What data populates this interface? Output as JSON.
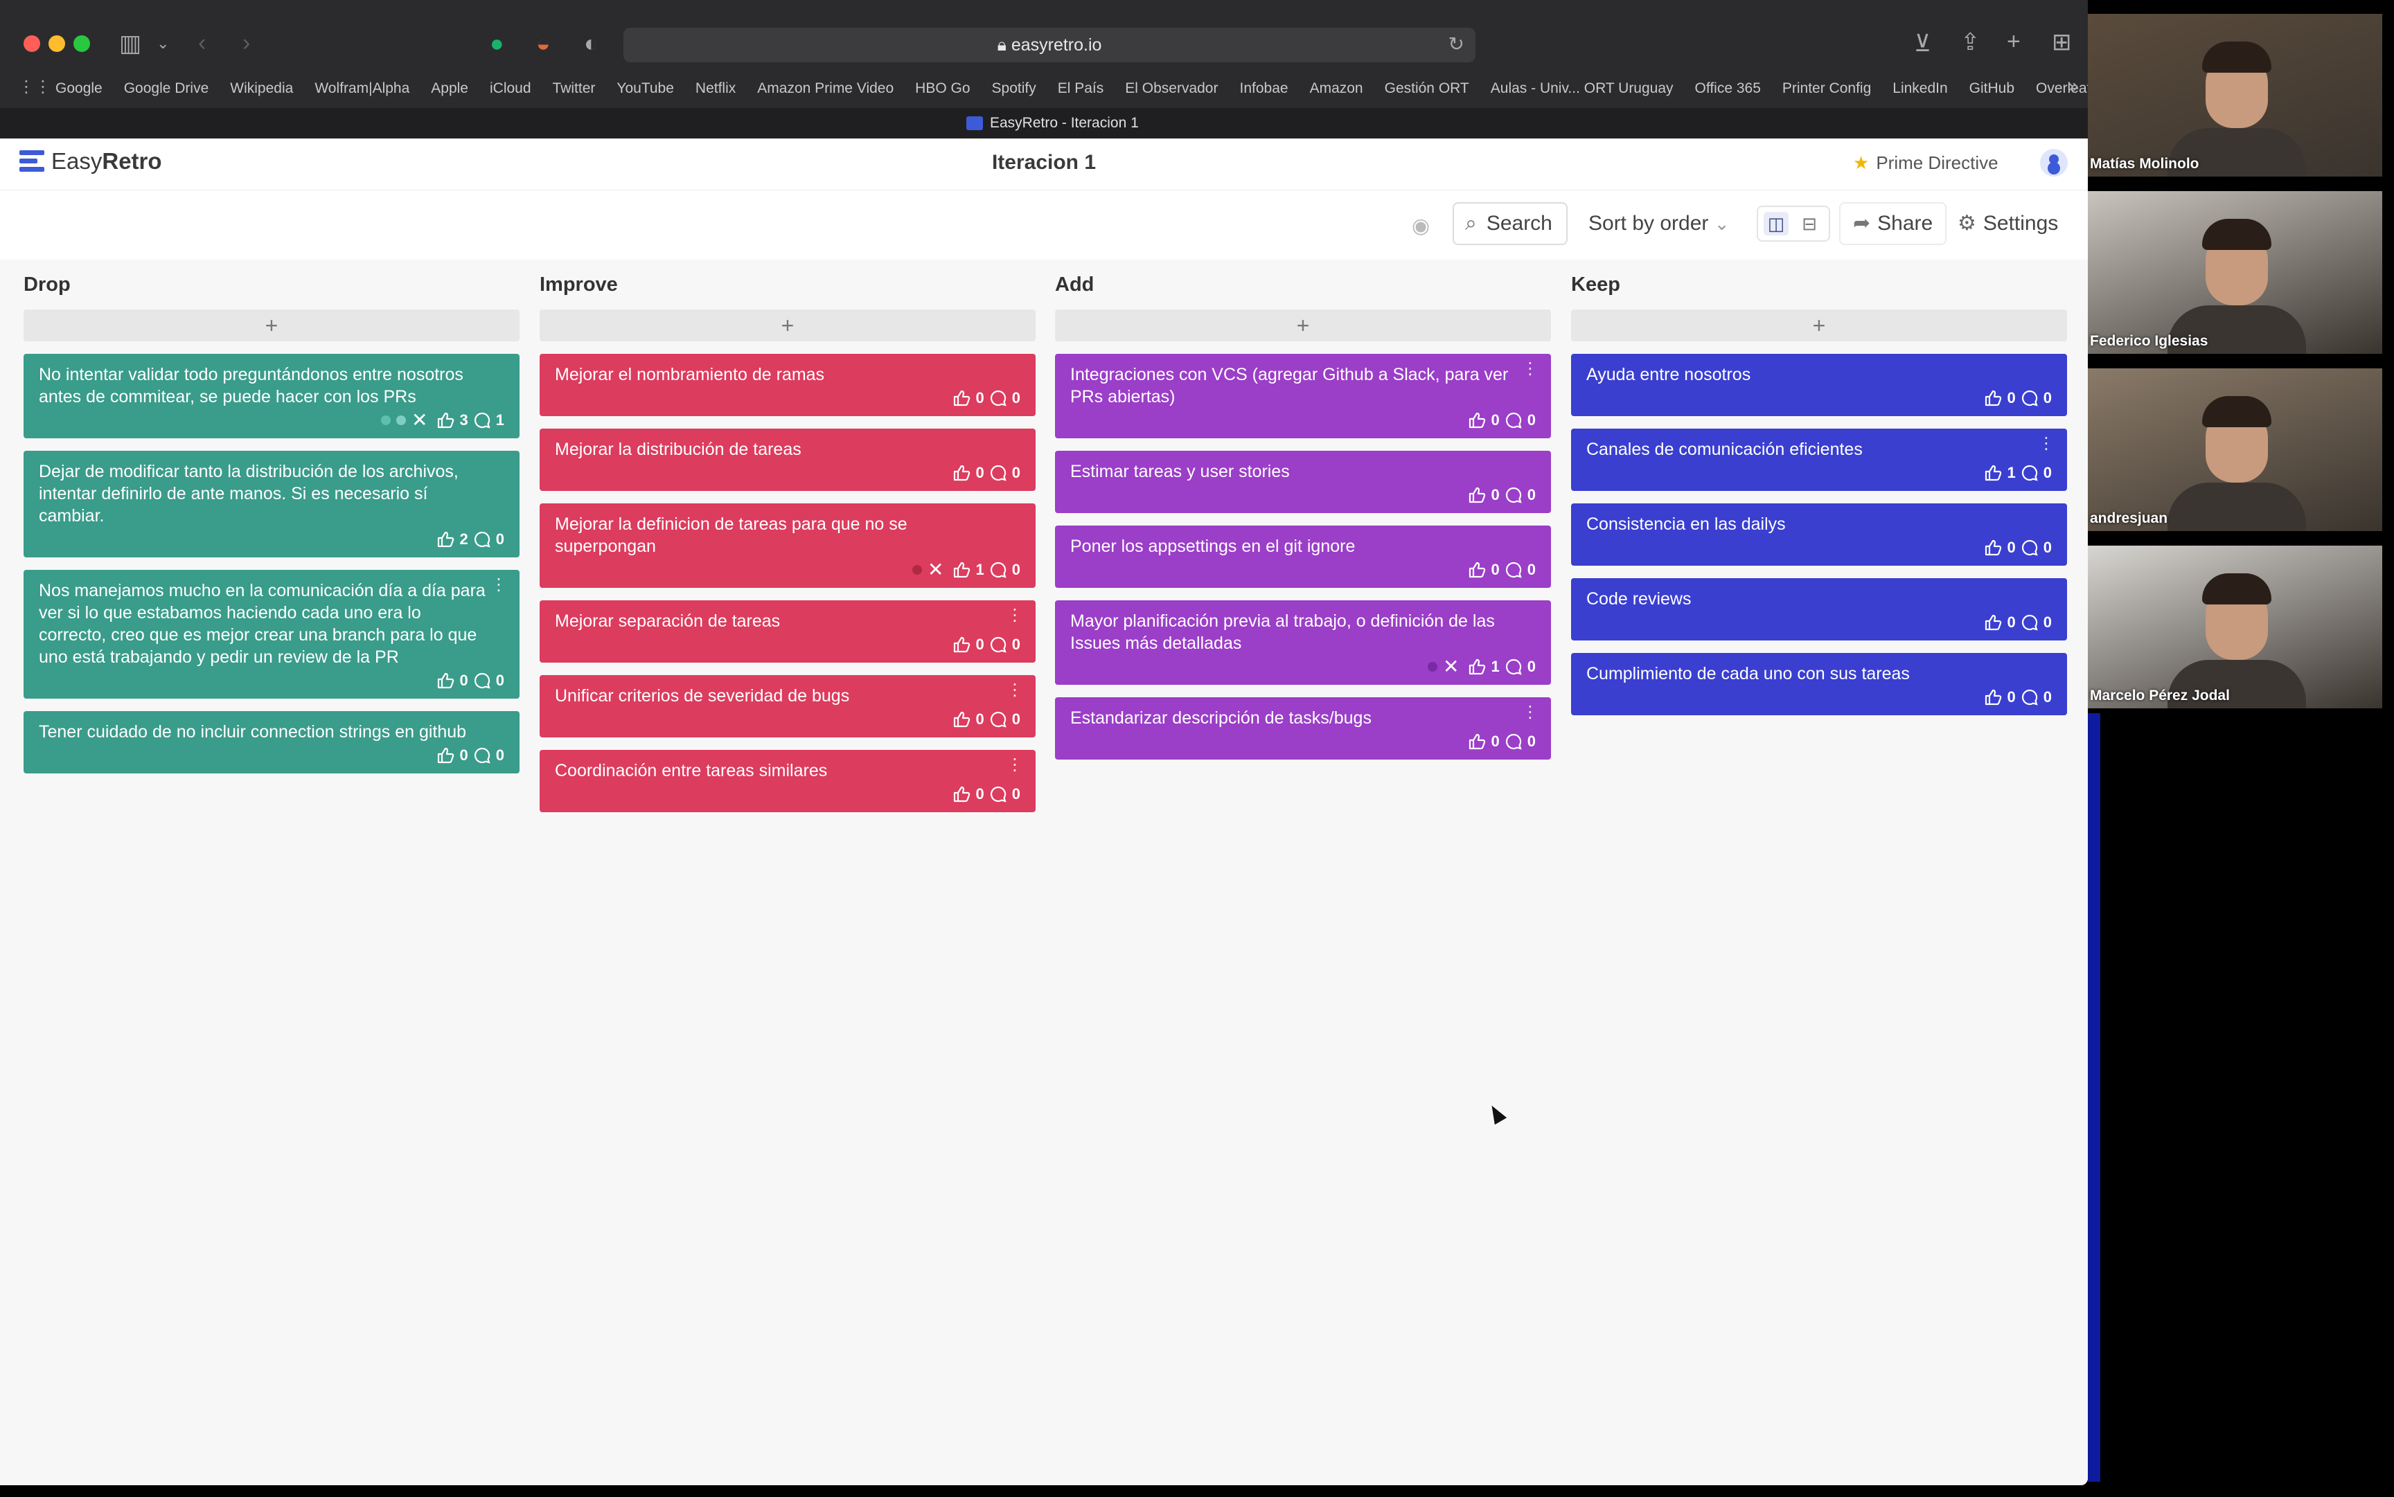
{
  "browser": {
    "url": "easyretro.io",
    "tab_title": "EasyRetro - Iteracion 1",
    "bookmarks": [
      "Google",
      "Google Drive",
      "Wikipedia",
      "Wolfram|Alpha",
      "Apple",
      "iCloud",
      "Twitter",
      "YouTube",
      "Netflix",
      "Amazon Prime Video",
      "HBO Go",
      "Spotify",
      "El País",
      "El Observador",
      "Infobae",
      "Amazon",
      "Gestión ORT",
      "Aulas - Univ... ORT Uruguay",
      "Office 365",
      "Printer Config",
      "LinkedIn",
      "GitHub",
      "Overleaf"
    ]
  },
  "app": {
    "logo_easy": "Easy",
    "logo_retro": "Retro",
    "board_title": "Iteracion 1",
    "prime_directive": "Prime Directive",
    "search_label": "Search",
    "sort_label": "Sort by order",
    "share_label": "Share",
    "settings_label": "Settings"
  },
  "columns": [
    {
      "title": "Drop",
      "color": "#3a9c8a",
      "cards": [
        {
          "text": "No intentar validar todo preguntándonos entre nosotros antes de commitear, se puede hacer con los PRs",
          "likes": "3",
          "comments": "1",
          "has_x": true,
          "dots": [
            "#5fbfae",
            "#7fcfc0"
          ]
        },
        {
          "text": "Dejar de modificar tanto la distribución de los archivos, intentar definirlo de ante manos. Si es necesario sí cambiar.",
          "likes": "2",
          "comments": "0"
        },
        {
          "text": "Nos manejamos mucho en la comunicación día a día para ver si lo que estabamos haciendo cada uno era lo correcto, creo que es mejor crear una branch para lo que uno está trabajando y pedir un review de la PR",
          "likes": "0",
          "comments": "0",
          "kebab": true
        },
        {
          "text": "Tener cuidado de no incluir connection strings en github",
          "likes": "0",
          "comments": "0"
        }
      ]
    },
    {
      "title": "Improve",
      "color": "#dc3c5e",
      "cards": [
        {
          "text": "Mejorar el nombramiento de ramas",
          "likes": "0",
          "comments": "0"
        },
        {
          "text": "Mejorar la distribución de tareas",
          "likes": "0",
          "comments": "0"
        },
        {
          "text": "Mejorar la definicion de tareas para que no se superpongan",
          "likes": "1",
          "comments": "0",
          "has_x": true,
          "dots": [
            "#b02847"
          ]
        },
        {
          "text": "Mejorar separación de tareas",
          "likes": "0",
          "comments": "0",
          "kebab": true
        },
        {
          "text": "Unificar criterios de severidad de bugs",
          "likes": "0",
          "comments": "0",
          "kebab": true
        },
        {
          "text": "Coordinación entre tareas similares",
          "likes": "0",
          "comments": "0",
          "kebab": true
        }
      ]
    },
    {
      "title": "Add",
      "color": "#9b3ec8",
      "cards": [
        {
          "text": "Integraciones con VCS (agregar Github a Slack, para ver PRs abiertas)",
          "likes": "0",
          "comments": "0",
          "kebab": true
        },
        {
          "text": "Estimar tareas y user stories",
          "likes": "0",
          "comments": "0"
        },
        {
          "text": "Poner los appsettings en el git ignore",
          "likes": "0",
          "comments": "0"
        },
        {
          "text": "Mayor planificación previa al trabajo, o definición de las Issues más detalladas",
          "likes": "1",
          "comments": "0",
          "has_x": true,
          "dots": [
            "#7a2aa3"
          ]
        },
        {
          "text": "Estandarizar descripción de tasks/bugs",
          "likes": "0",
          "comments": "0",
          "kebab": true
        }
      ]
    },
    {
      "title": "Keep",
      "color": "#3a3fd0",
      "cards": [
        {
          "text": "Ayuda entre nosotros",
          "likes": "0",
          "comments": "0"
        },
        {
          "text": "Canales de comunicación eficientes",
          "likes": "1",
          "comments": "0",
          "kebab": true
        },
        {
          "text": "Consistencia en las dailys",
          "likes": "0",
          "comments": "0"
        },
        {
          "text": "Code reviews",
          "likes": "0",
          "comments": "0"
        },
        {
          "text": "Cumplimiento de cada uno con sus tareas",
          "likes": "0",
          "comments": "0"
        }
      ]
    }
  ],
  "participants": [
    {
      "name": "Matías Molinolo",
      "bg": "#5a4b3c"
    },
    {
      "name": "Federico Iglesias",
      "bg": "#c9c4bd"
    },
    {
      "name": "andresjuan",
      "bg": "#8a7a68"
    },
    {
      "name": "Marcelo Pérez Jodal",
      "bg": "#d8d6d2"
    }
  ]
}
